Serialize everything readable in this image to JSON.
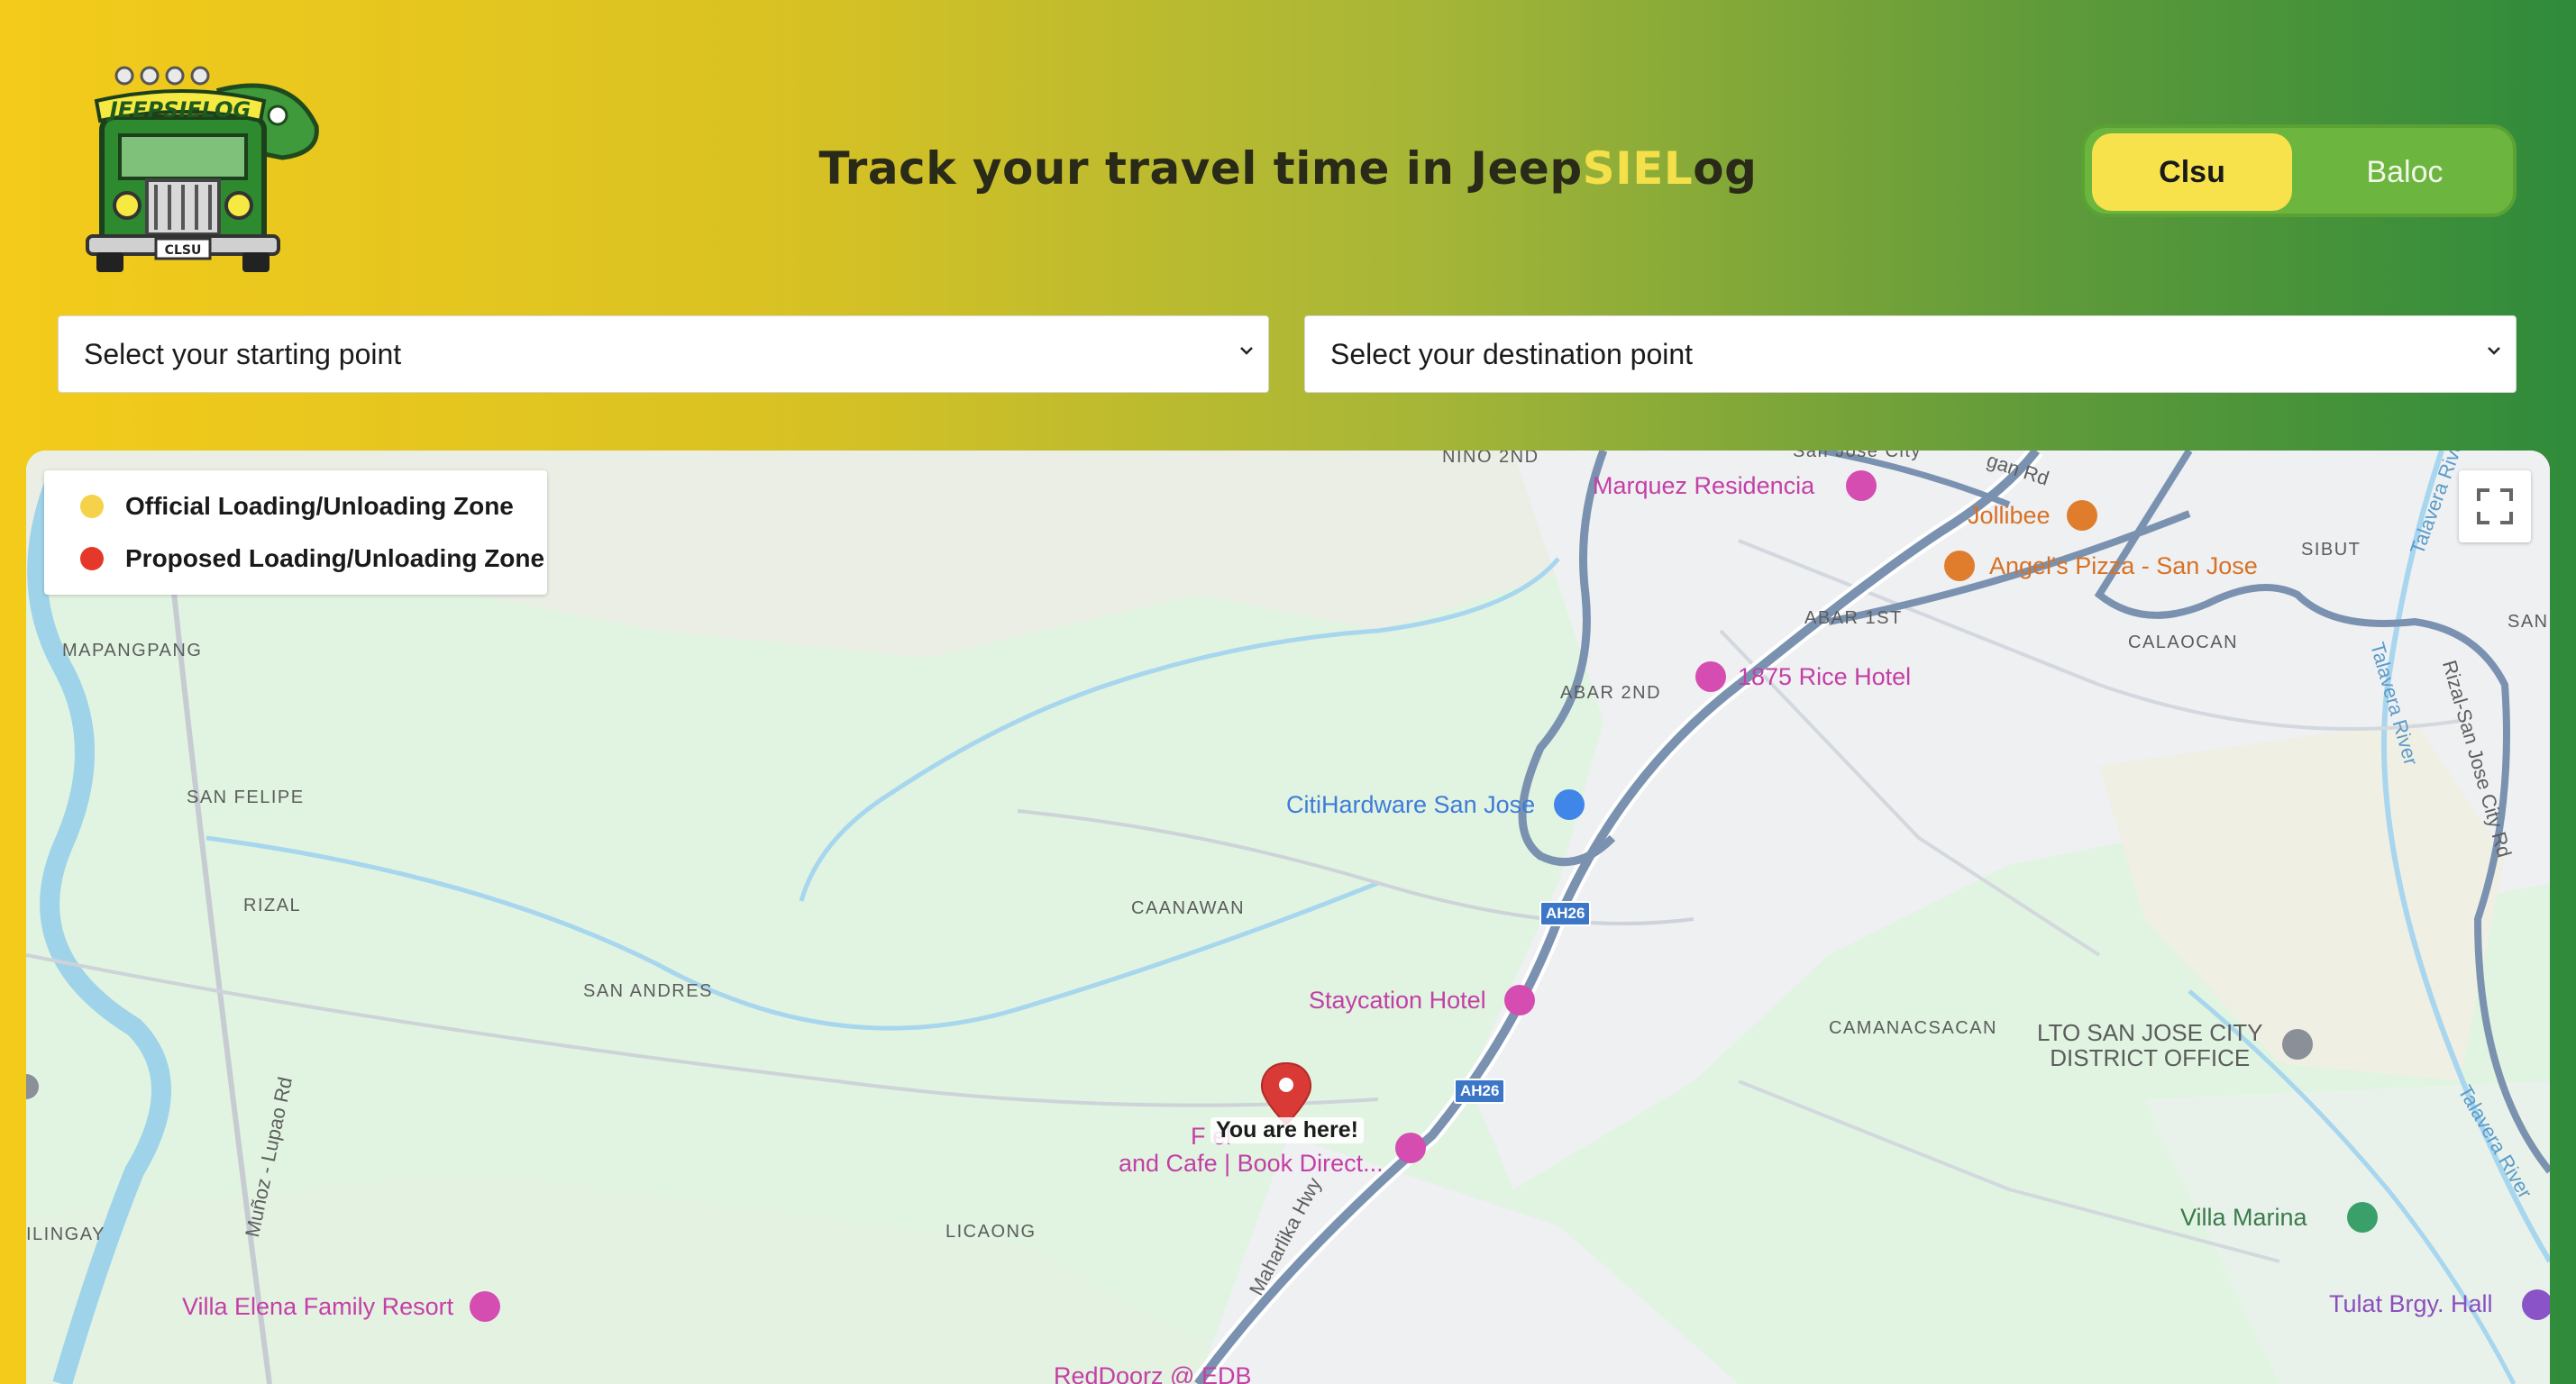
{
  "header": {
    "logo_text": "JEEPSIELOG",
    "logo_plate": "CLSU",
    "title_prefix": "Track your travel time in Jeep",
    "title_highlight": "SIEL",
    "title_suffix": "og",
    "toggle": {
      "active": "Clsu",
      "inactive": "Baloc"
    }
  },
  "selects": {
    "start_placeholder": "Select your starting point",
    "destination_placeholder": "Select your destination point"
  },
  "legend": {
    "items": [
      {
        "label": "Official Loading/Unloading Zone",
        "color": "#f5d24a"
      },
      {
        "label": "Proposed Loading/Unloading Zone",
        "color": "#e5382a"
      }
    ]
  },
  "map": {
    "marker_label": "You are here!",
    "areas": [
      "NINO 2ND",
      "MAPANGPANG",
      "SAN FELIPE",
      "RIZAL",
      "SAN ANDRES",
      "CAANAWAN",
      "LICAONG",
      "ABAR 2ND",
      "ABAR 1ST",
      "SIBUT",
      "CALAOCAN",
      "CAMANACSACAN",
      "SAN",
      "ILINGAY"
    ],
    "pois": {
      "marquez": "Marquez Residencia",
      "jollibee": "Jollibee",
      "angels": "Angel's Pizza - San Jose",
      "rice_hotel": "1875 Rice Hotel",
      "citihardware": "CitiHardware San Jose",
      "staycation": "Staycation Hotel",
      "cafe_line1": "F            el",
      "cafe_line2": "and Cafe | Book Direct...",
      "lto_line1": "LTO SAN JOSE CITY",
      "lto_line2": "DISTRICT OFFICE",
      "villa_marina": "Villa Marina",
      "villa_elena": "Villa Elena Family Resort",
      "tulat": "Tulat Brgy. Hall",
      "reddoorz": "RedDoorz @ EDB"
    },
    "roads": {
      "ah26_a": "AH26",
      "ah26_b": "AH26",
      "maharlika": "Maharlika Hwy",
      "munoz": "Muñoz - Lupao Rd",
      "rizal_sj": "Rizal-San Jose City Rd",
      "talavera_1": "Talavera River",
      "talavera_2": "Talavera River",
      "talavera_3": "Talavera River",
      "gan_rd": "gan Rd",
      "city_top": "San Jose City"
    }
  }
}
